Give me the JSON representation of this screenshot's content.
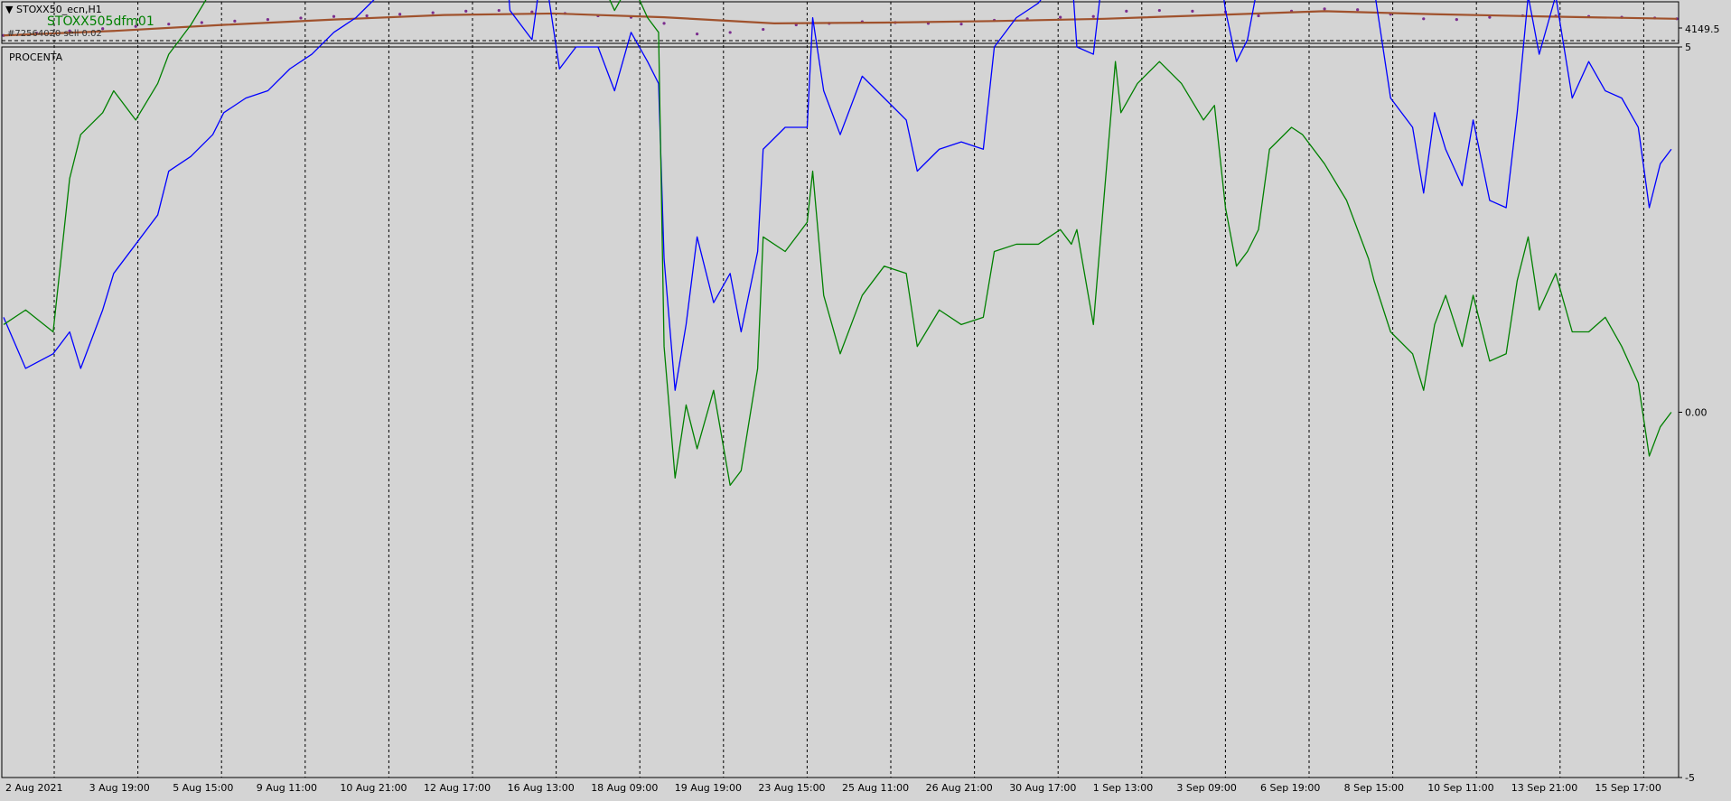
{
  "window": {
    "symbol_label": "STOXX50_ecn,H1",
    "indicator_label": "STOXX505dfm01",
    "info_line": "#72564020 sell 0.02",
    "subwindow_label": "PROCENTA"
  },
  "price_pane": {
    "price_label": "4149.5"
  },
  "indicator_pane": {
    "y_ticks": [
      "5",
      "0.00",
      "-5"
    ]
  },
  "x_labels": [
    "2 Aug 2021",
    "3 Aug 19:00",
    "5 Aug 15:00",
    "9 Aug 11:00",
    "10 Aug 21:00",
    "12 Aug 17:00",
    "16 Aug 13:00",
    "18 Aug 09:00",
    "19 Aug 19:00",
    "23 Aug 15:00",
    "25 Aug 11:00",
    "26 Aug 21:00",
    "30 Aug 17:00",
    "1 Sep 13:00",
    "3 Sep 09:00",
    "6 Sep 19:00",
    "8 Sep 15:00",
    "10 Sep 11:00",
    "13 Sep 21:00",
    "15 Sep 17:00"
  ],
  "colors": {
    "background": "#d4d4d4",
    "grid": "#000000",
    "blue_series": "#0000ff",
    "green_series": "#008000",
    "ma_line": "#a0522d",
    "price_dots": "#7b2d8e",
    "indicator_text": "#008000"
  },
  "chart_data": [
    {
      "type": "line",
      "panel": "price",
      "ylim": [
        4000,
        4250
      ],
      "series": [
        {
          "role": "price",
          "x": [
            0,
            30,
            60,
            90,
            120,
            150,
            180,
            210,
            240,
            270,
            300,
            330,
            360,
            390,
            420,
            450,
            480,
            510,
            540,
            570,
            600,
            630,
            660,
            690,
            720,
            750,
            780,
            810,
            840,
            870,
            900,
            930,
            960,
            990,
            1020,
            1050,
            1080,
            1110,
            1140,
            1170,
            1200,
            1230,
            1260,
            1290,
            1320,
            1350,
            1380,
            1410,
            1440,
            1470,
            1500,
            1520
          ],
          "values": [
            4040,
            4055,
            4070,
            4085,
            4100,
            4115,
            4125,
            4135,
            4145,
            4155,
            4165,
            4170,
            4180,
            4190,
            4200,
            4205,
            4195,
            4185,
            4170,
            4160,
            4120,
            4050,
            4060,
            4080,
            4110,
            4120,
            4130,
            4125,
            4120,
            4115,
            4140,
            4150,
            4160,
            4165,
            4200,
            4205,
            4200,
            4195,
            4170,
            4200,
            4215,
            4210,
            4180,
            4150,
            4145,
            4160,
            4170,
            4168,
            4165,
            4160,
            4155,
            4150
          ]
        },
        {
          "role": "moving-average",
          "x": [
            0,
            100,
            200,
            300,
            400,
            500,
            600,
            700,
            800,
            900,
            1000,
            1100,
            1200,
            1300,
            1400,
            1520
          ],
          "values": [
            4040,
            4070,
            4110,
            4145,
            4175,
            4185,
            4160,
            4120,
            4125,
            4135,
            4150,
            4175,
            4200,
            4180,
            4165,
            4150
          ]
        }
      ]
    },
    {
      "type": "line",
      "panel": "indicator",
      "ylim": [
        -5,
        5
      ],
      "series": [
        {
          "role": "blue",
          "x": [
            0,
            20,
            45,
            60,
            70,
            90,
            100,
            120,
            140,
            150,
            170,
            190,
            200,
            220,
            240,
            260,
            280,
            300,
            320,
            340,
            360,
            370,
            390,
            410,
            425,
            440,
            455,
            460,
            480,
            490,
            505,
            520,
            540,
            555,
            570,
            585,
            595,
            600,
            610,
            620,
            630,
            645,
            660,
            670,
            685,
            690,
            710,
            730,
            735,
            745,
            760,
            780,
            800,
            820,
            830,
            850,
            870,
            890,
            900,
            920,
            940,
            960,
            970,
            975,
            990,
            1010,
            1015,
            1030,
            1050,
            1070,
            1090,
            1100,
            1110,
            1120,
            1130,
            1140,
            1150,
            1170,
            1180,
            1200,
            1220,
            1240,
            1245,
            1260,
            1280,
            1290,
            1300,
            1310,
            1325,
            1335,
            1350,
            1365,
            1375,
            1385,
            1395,
            1410,
            1425,
            1440,
            1455,
            1470,
            1485,
            1495,
            1505,
            1515
          ],
          "values": [
            1.3,
            0.6,
            0.8,
            1.1,
            0.6,
            1.4,
            1.9,
            2.3,
            2.7,
            3.3,
            3.5,
            3.8,
            4.1,
            4.3,
            4.4,
            4.7,
            4.9,
            5.2,
            5.4,
            5.7,
            5.9,
            6.2,
            6.8,
            7.3,
            7.3,
            6.8,
            6.4,
            5.5,
            5.1,
            6.2,
            4.7,
            5.0,
            5.0,
            4.4,
            5.2,
            4.8,
            4.5,
            2.1,
            0.3,
            1.2,
            2.4,
            1.5,
            1.9,
            1.1,
            2.2,
            3.6,
            3.9,
            3.9,
            5.4,
            4.4,
            3.8,
            4.6,
            4.3,
            4.0,
            3.3,
            3.6,
            3.7,
            3.6,
            5.0,
            5.4,
            5.6,
            6.0,
            6.1,
            5.0,
            4.9,
            7.5,
            6.8,
            7.6,
            7.1,
            6.9,
            6.5,
            6.6,
            5.5,
            4.8,
            5.1,
            5.9,
            7.5,
            7.4,
            7.7,
            7.3,
            6.9,
            6.1,
            5.8,
            4.3,
            3.9,
            3.0,
            4.1,
            3.6,
            3.1,
            4.0,
            2.9,
            2.8,
            4.1,
            5.7,
            4.9,
            5.7,
            4.3,
            4.8,
            4.4,
            4.3,
            3.9,
            2.8,
            3.4,
            3.6
          ]
        },
        {
          "role": "green",
          "x": [
            0,
            20,
            45,
            60,
            70,
            90,
            100,
            120,
            140,
            150,
            170,
            190,
            200,
            220,
            240,
            260,
            280,
            300,
            320,
            340,
            360,
            370,
            390,
            410,
            425,
            440,
            455,
            460,
            480,
            490,
            505,
            520,
            540,
            555,
            570,
            585,
            595,
            600,
            610,
            620,
            630,
            645,
            660,
            670,
            685,
            690,
            710,
            730,
            735,
            745,
            760,
            780,
            800,
            820,
            830,
            850,
            870,
            890,
            900,
            920,
            940,
            960,
            970,
            975,
            990,
            1010,
            1015,
            1030,
            1050,
            1070,
            1090,
            1100,
            1110,
            1120,
            1130,
            1140,
            1150,
            1170,
            1180,
            1200,
            1220,
            1240,
            1245,
            1260,
            1280,
            1290,
            1300,
            1310,
            1325,
            1335,
            1350,
            1365,
            1375,
            1385,
            1395,
            1410,
            1425,
            1440,
            1455,
            1470,
            1485,
            1495,
            1505,
            1515
          ],
          "values": [
            1.2,
            1.4,
            1.1,
            3.2,
            3.8,
            4.1,
            4.4,
            4.0,
            4.5,
            4.9,
            5.3,
            5.8,
            6.1,
            6.3,
            6.2,
            6.3,
            6.6,
            6.8,
            6.9,
            7.3,
            7.6,
            7.7,
            8.3,
            8.5,
            8.9,
            8.2,
            8.1,
            7.6,
            7.4,
            8.1,
            6.2,
            6.0,
            6.0,
            5.5,
            5.9,
            5.4,
            5.2,
            0.9,
            -0.9,
            0.1,
            -0.5,
            0.3,
            -1.0,
            -0.8,
            0.6,
            2.4,
            2.2,
            2.6,
            3.3,
            1.6,
            0.8,
            1.6,
            2.0,
            1.9,
            0.9,
            1.4,
            1.2,
            1.3,
            2.2,
            2.3,
            2.3,
            2.5,
            2.3,
            2.5,
            1.2,
            4.8,
            4.1,
            4.5,
            4.8,
            4.5,
            4.0,
            4.2,
            2.8,
            2.0,
            2.2,
            2.5,
            3.6,
            3.9,
            3.8,
            3.4,
            2.9,
            2.1,
            1.8,
            1.1,
            0.8,
            0.3,
            1.2,
            1.6,
            0.9,
            1.6,
            0.7,
            0.8,
            1.8,
            2.4,
            1.4,
            1.9,
            1.1,
            1.1,
            1.3,
            0.9,
            0.4,
            -0.6,
            -0.2,
            0.0
          ]
        }
      ]
    }
  ]
}
